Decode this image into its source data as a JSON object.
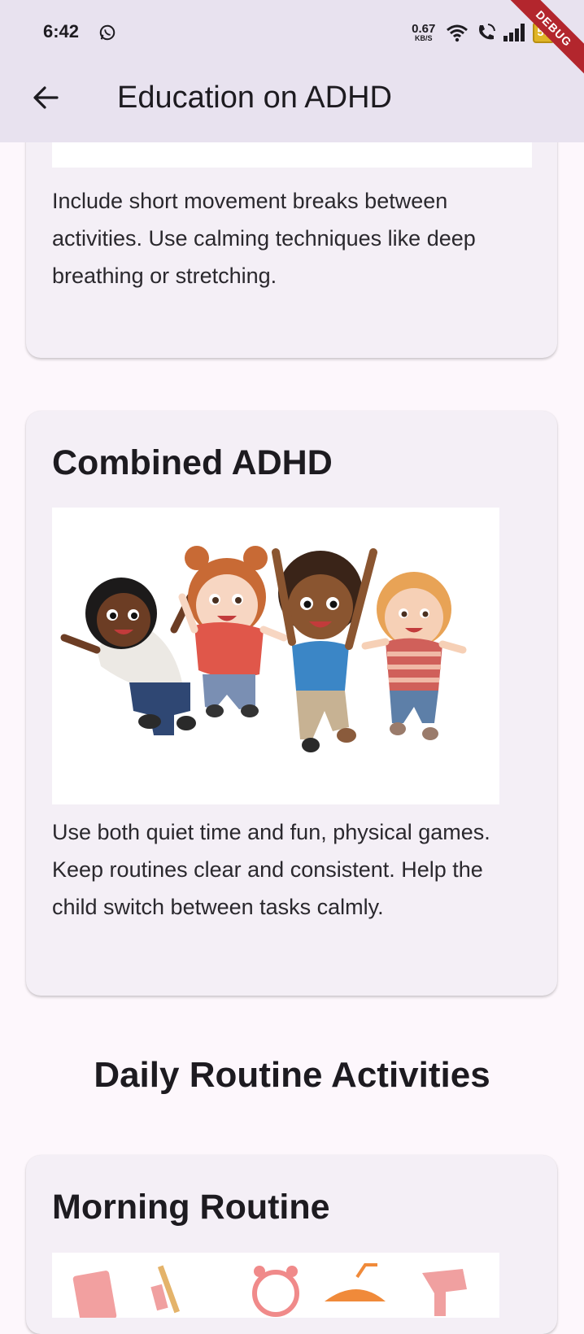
{
  "status_bar": {
    "time": "6:42",
    "net_speed_value": "0.67",
    "net_speed_unit": "KB/S",
    "battery": "50",
    "debug_banner": "DEBUG"
  },
  "app_bar": {
    "title": "Education on ADHD"
  },
  "cards": [
    {
      "description": "Include short movement breaks between activities. Use calming techniques like deep breathing or stretching."
    },
    {
      "title": "Combined ADHD",
      "image_subject": "four cartoon children jumping happily",
      "description": "Use both quiet time and fun, physical games. Keep routines clear and consistent. Help the child switch between tasks calmly."
    }
  ],
  "section": {
    "heading": "Daily Routine Activities"
  },
  "routine_cards": [
    {
      "title": "Morning Routine",
      "image_subject": "morning routine items: book, toothbrush, alarm clock, orange juice, hair dryer"
    }
  ],
  "colors": {
    "app_bar_bg": "#e8e2ef",
    "page_bg": "#fdf7fc",
    "card_bg": "#f4eff6",
    "debug_ribbon": "#b3262d",
    "battery": "#e0b526"
  }
}
